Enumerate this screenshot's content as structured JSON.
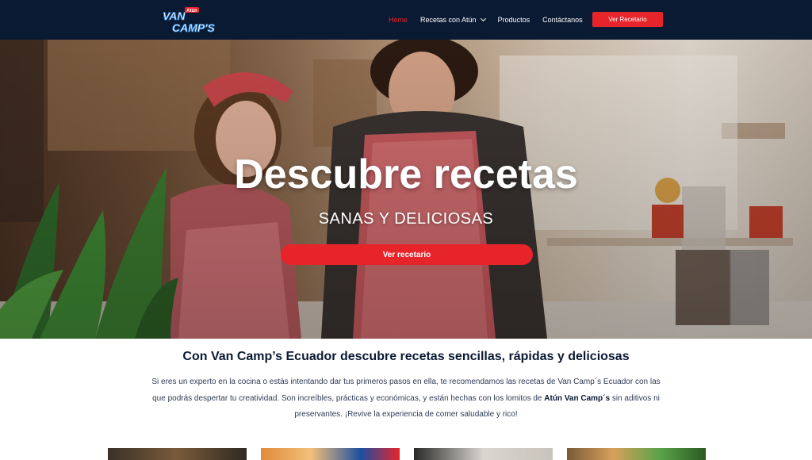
{
  "brand": {
    "logo_top": "Atún",
    "logo_line1": "VAN",
    "logo_line2": "CAMP'S"
  },
  "nav": {
    "items": [
      {
        "label": "Home",
        "active": true
      },
      {
        "label": "Recetas con Atún",
        "dropdown": true
      },
      {
        "label": "Productos"
      },
      {
        "label": "Contáctanos"
      }
    ],
    "cta": "Ver Recetario"
  },
  "hero": {
    "title": "Descubre recetas",
    "subtitle": "SANAS Y DELICIOSAS",
    "button": "Ver recetario"
  },
  "intro": {
    "title": "Con Van Camp’s Ecuador descubre recetas sencillas, rápidas y deliciosas",
    "text_1": "Si eres un experto en la cocina o estás intentando dar tus primeros pasos en ella, te recomendamos las recetas de Van Camp´s Ecuador con las que podrás despertar tu creatividad. Son increíbles, prácticas y económicas, y están hechas con los lomitos de ",
    "text_bold": "Atún Van Camp´s",
    "text_2": " sin aditivos ni preservantes. ¡Revive la experiencia de comer saludable y rico!"
  },
  "colors": {
    "navy": "#0b1a33",
    "red": "#e8242b",
    "text": "#2d3b55"
  }
}
